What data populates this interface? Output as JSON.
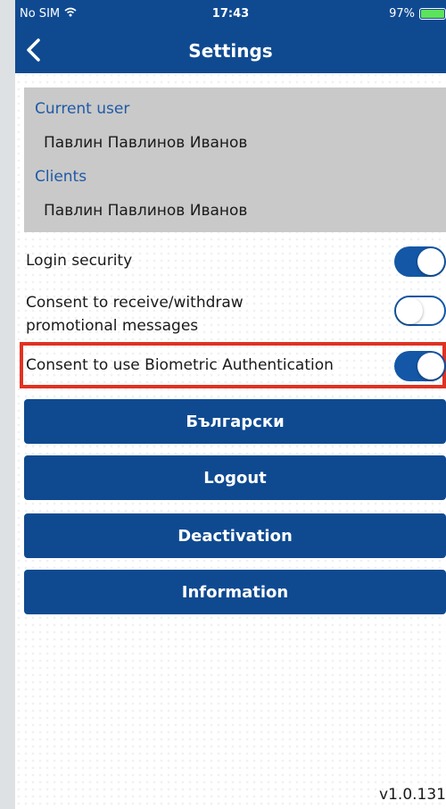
{
  "status_bar": {
    "carrier": "No SIM",
    "time": "17:43",
    "battery": "97%",
    "battery_level": 0.97
  },
  "nav": {
    "title": "Settings",
    "back_icon": "chevron-left-icon"
  },
  "user_info": {
    "current_user_label": "Current user",
    "current_user_name": "Павлин Павлинов Иванов",
    "clients_label": "Clients",
    "client_name": "Павлин Павлинов Иванов"
  },
  "settings": [
    {
      "label": "Login security",
      "enabled": true
    },
    {
      "label_line1": "Consent to receive/withdraw",
      "label_line2": "promotional messages",
      "enabled": false
    },
    {
      "label": "Consent to use Biometric Authentication",
      "enabled": true,
      "highlighted": true
    }
  ],
  "buttons": {
    "language": "Български",
    "logout": "Logout",
    "deactivation": "Deactivation",
    "information": "Information"
  },
  "version": "v1.0.131",
  "colors": {
    "primary": "#0f4a91",
    "toggle_on": "#1457a6",
    "label_blue": "#1f5aa6",
    "highlight": "#e03222",
    "user_box_bg": "#c9c9c9",
    "battery": "#5ce35c"
  }
}
